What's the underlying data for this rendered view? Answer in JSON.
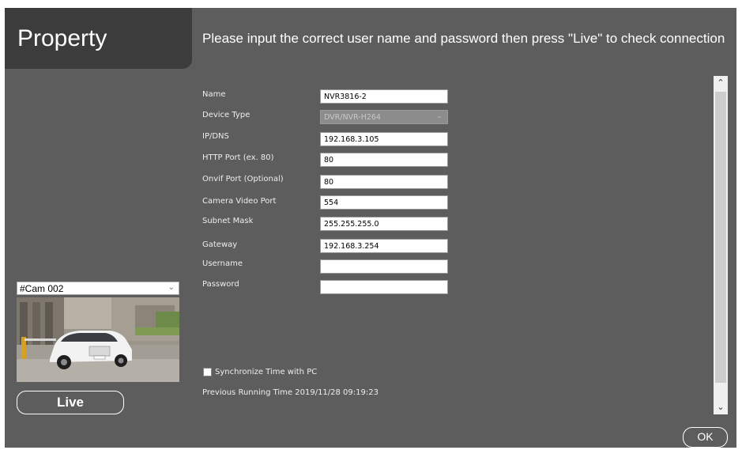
{
  "header": {
    "title": "Property",
    "instruction": "Please input the correct user name and password then press \"Live\" to check connection"
  },
  "form": {
    "name": {
      "label": "Name",
      "value": "NVR3816-2"
    },
    "device_type": {
      "label": "Device Type",
      "value": "DVR/NVR-H264"
    },
    "ip_dns": {
      "label": "IP/DNS",
      "value": "192.168.3.105"
    },
    "http_port": {
      "label": "HTTP Port (ex. 80)",
      "value": "80"
    },
    "onvif_port": {
      "label": "Onvif Port (Optional)",
      "value": "80"
    },
    "video_port": {
      "label": "Camera Video Port",
      "value": "554"
    },
    "subnet_mask": {
      "label": "Subnet Mask",
      "value": "255.255.255.0"
    },
    "gateway": {
      "label": "Gateway",
      "value": "192.168.3.254"
    },
    "username": {
      "label": "Username",
      "value": ""
    },
    "password": {
      "label": "Password",
      "value": ""
    },
    "sync_time": {
      "label": "Synchronize Time with PC",
      "checked": false
    },
    "previous_running": "Previous Running Time 2019/11/28 09:19:23"
  },
  "camera": {
    "selected": "#Cam 002"
  },
  "buttons": {
    "live": "Live",
    "ok": "OK"
  },
  "icons": {
    "dropdown": "chevron-down-icon",
    "scroll_up": "chevron-up-icon",
    "scroll_down": "chevron-down-icon"
  },
  "colors": {
    "window_bg": "#5d5d5d",
    "title_tab_bg": "#3c3c3c",
    "text": "#ffffff"
  }
}
